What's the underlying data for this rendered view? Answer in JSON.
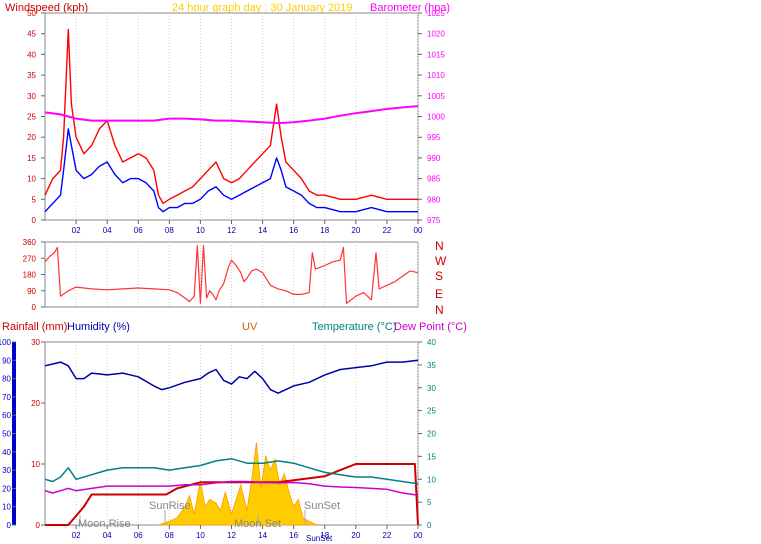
{
  "colors": {
    "wind_red": "#ff0000",
    "wind_blue": "#0000ff",
    "baro": "#ff00ff",
    "title_gold": "#ffcc00",
    "axis_darkred": "#cc0000",
    "axis_blue": "#0000cc",
    "humidity_navy": "#0000aa",
    "uv_brown": "#cc6600",
    "temp_teal": "#008080",
    "dew_magenta": "#cc00cc",
    "rain_darkred": "#cc0000",
    "uv_fill": "#ffcc00",
    "uv_edge": "#ff9900",
    "dir_red": "#ff3333",
    "hours_blue": "#0000aa",
    "grid": "#999999"
  },
  "header": {
    "wind_label": "Windspeed (kph)",
    "title": "24 hour graph day : 30 January 2019",
    "baro_label": "Barometer (hpa)"
  },
  "bottom_header": {
    "rain_label": "Rainfall (mm)",
    "humidity_label": "Humidity (%)",
    "uv_label": "UV",
    "temp_label": "Temperature (°C)",
    "dew_label": "Dew Point (°C)"
  },
  "compass": [
    "N",
    "W",
    "S",
    "E",
    "N"
  ],
  "annotations": {
    "moon_rise": "Moon Rise",
    "sun_rise": "SunRise",
    "moon_set": "Moon Set",
    "sun_set": "SunSet"
  },
  "chart_data": [
    {
      "type": "line",
      "name": "wind-barometer",
      "x_unit": "hour",
      "xlim": [
        0,
        24
      ],
      "x_ticks": [
        "02",
        "04",
        "06",
        "08",
        "10",
        "12",
        "14",
        "16",
        "18",
        "20",
        "22",
        "00"
      ],
      "ylim_left": [
        0,
        50
      ],
      "y_ticks_left": [
        "0",
        "5",
        "10",
        "15",
        "20",
        "25",
        "30",
        "35",
        "40",
        "45",
        "50"
      ],
      "ylim_right": [
        975,
        1025
      ],
      "y_ticks_right": [
        "975",
        "980",
        "985",
        "990",
        "995",
        "1000",
        "1005",
        "1010",
        "1015",
        "1020",
        "1025"
      ],
      "series": [
        {
          "axis": "left",
          "color": "#ff0000",
          "x": [
            0,
            0.5,
            1,
            1.2,
            1.5,
            1.7,
            2,
            2.5,
            3,
            3.5,
            4,
            4.5,
            5,
            5.5,
            6,
            6.5,
            7,
            7.3,
            7.6,
            8,
            8.5,
            9,
            9.5,
            10,
            10.5,
            11,
            11.5,
            12,
            12.5,
            13,
            13.5,
            14,
            14.5,
            14.9,
            15.2,
            15.5,
            16,
            16.5,
            17,
            17.5,
            18,
            19,
            20,
            21,
            22,
            23,
            24
          ],
          "y": [
            6,
            10,
            12,
            20,
            46,
            28,
            20,
            16,
            18,
            22,
            24,
            18,
            14,
            15,
            16,
            15,
            12,
            6,
            4,
            5,
            6,
            7,
            8,
            10,
            12,
            14,
            10,
            9,
            10,
            12,
            14,
            16,
            18,
            28,
            20,
            14,
            12,
            10,
            7,
            6,
            6,
            5,
            5,
            6,
            5,
            5,
            5
          ]
        },
        {
          "axis": "left",
          "color": "#0000ff",
          "x": [
            0,
            0.5,
            1,
            1.2,
            1.5,
            1.7,
            2,
            2.5,
            3,
            3.5,
            4,
            4.5,
            5,
            5.5,
            6,
            6.5,
            7,
            7.3,
            7.6,
            8,
            8.5,
            9,
            9.5,
            10,
            10.5,
            11,
            11.5,
            12,
            12.5,
            13,
            13.5,
            14,
            14.5,
            14.9,
            15.2,
            15.5,
            16,
            16.5,
            17,
            17.5,
            18,
            19,
            20,
            21,
            22,
            23,
            24
          ],
          "y": [
            2,
            4,
            6,
            12,
            22,
            18,
            12,
            10,
            11,
            13,
            14,
            11,
            9,
            10,
            10,
            9,
            7,
            3,
            2,
            3,
            3,
            4,
            4,
            5,
            7,
            8,
            6,
            5,
            6,
            7,
            8,
            9,
            10,
            15,
            12,
            8,
            7,
            6,
            4,
            3,
            3,
            2,
            2,
            3,
            2,
            2,
            2
          ]
        },
        {
          "axis": "right",
          "color": "#ff00ff",
          "x": [
            0,
            1,
            2,
            3,
            4,
            5,
            6,
            7,
            8,
            9,
            10,
            11,
            12,
            13,
            14,
            15,
            16,
            17,
            18,
            19,
            20,
            21,
            22,
            23,
            24
          ],
          "y": [
            1001,
            1000.5,
            999.5,
            999,
            999,
            999,
            999,
            999,
            999.5,
            999.5,
            999.3,
            999,
            999,
            998.8,
            998.6,
            998.4,
            998.6,
            999,
            999.5,
            1000.2,
            1000.8,
            1001.3,
            1001.8,
            1002.2,
            1002.5
          ]
        }
      ]
    },
    {
      "type": "line",
      "name": "wind-direction",
      "x_unit": "hour",
      "xlim": [
        0,
        24
      ],
      "ylim": [
        0,
        360
      ],
      "y_ticks": [
        "0",
        "90",
        "180",
        "270",
        "360"
      ],
      "series": [
        {
          "color": "#ff3333",
          "x": [
            0,
            0.3,
            0.6,
            0.8,
            1,
            1.5,
            2,
            3,
            4,
            5,
            6,
            7,
            8,
            8.5,
            9,
            9.3,
            9.6,
            9.8,
            10,
            10.2,
            10.4,
            10.6,
            10.8,
            11,
            11.2,
            11.5,
            11.8,
            12,
            12.3,
            12.6,
            12.8,
            13,
            13.3,
            13.6,
            14,
            14.5,
            15,
            15.5,
            16,
            16.5,
            17,
            17.2,
            17.4,
            18,
            18.5,
            19,
            19.2,
            19.4,
            20,
            20.5,
            21,
            21.3,
            21.5,
            22,
            22.5,
            23,
            23.5,
            24
          ],
          "y": [
            250,
            280,
            300,
            330,
            60,
            90,
            110,
            100,
            95,
            100,
            105,
            100,
            95,
            80,
            50,
            30,
            60,
            340,
            20,
            340,
            50,
            90,
            70,
            40,
            90,
            130,
            220,
            260,
            230,
            190,
            140,
            160,
            200,
            210,
            190,
            120,
            100,
            90,
            70,
            70,
            80,
            300,
            210,
            230,
            250,
            260,
            330,
            20,
            60,
            80,
            40,
            300,
            100,
            120,
            140,
            170,
            200,
            190
          ]
        }
      ]
    },
    {
      "type": "area",
      "name": "rain-humidity-uv-temp",
      "x_unit": "hour",
      "xlim": [
        0,
        24
      ],
      "y_rain_ticks": [
        "0",
        "10",
        "20",
        "30"
      ],
      "ylim_rain": [
        0,
        30
      ],
      "y_hum_ticks": [
        "0",
        "10",
        "20",
        "30",
        "40",
        "50",
        "60",
        "70",
        "80",
        "90",
        "100"
      ],
      "ylim_hum": [
        0,
        100
      ],
      "y_temp_ticks": [
        "0",
        "5",
        "10",
        "15",
        "20",
        "25",
        "30",
        "35",
        "40"
      ],
      "ylim_temp": [
        0,
        40
      ],
      "series": [
        {
          "name": "Humidity (%)",
          "axis": "hum",
          "color": "#0000aa",
          "x": [
            0,
            0.5,
            1,
            1.5,
            2,
            2.5,
            3,
            4,
            5,
            6,
            7,
            7.5,
            8,
            9,
            10,
            10.5,
            11,
            11.5,
            12,
            12.5,
            13,
            13.5,
            14,
            14.5,
            15,
            15.5,
            16,
            17,
            18,
            19,
            20,
            21,
            22,
            23,
            24
          ],
          "y": [
            87,
            88,
            89,
            87,
            80,
            80,
            83,
            82,
            83,
            81,
            76,
            74,
            75,
            78,
            80,
            83,
            85,
            79,
            77,
            81,
            80,
            84,
            80,
            74,
            72,
            74,
            76,
            78,
            82,
            85,
            86,
            87,
            89,
            89,
            90
          ]
        },
        {
          "name": "Rainfall (mm)",
          "axis": "rain",
          "color": "#cc0000",
          "x": [
            0,
            1.5,
            2.5,
            3,
            6,
            7.8,
            8.5,
            10,
            10.5,
            12,
            15,
            18,
            19,
            20,
            23.8,
            24
          ],
          "y": [
            0,
            0,
            3,
            5,
            5,
            5,
            6,
            7,
            7,
            7,
            7,
            8,
            9,
            10,
            10,
            0
          ]
        },
        {
          "name": "Temperature (°C)",
          "axis": "temp",
          "color": "#008080",
          "x": [
            0,
            0.5,
            1,
            1.5,
            2,
            3,
            4,
            5,
            6,
            7,
            8,
            9,
            10,
            11,
            12,
            13,
            14,
            15,
            16,
            17,
            18,
            19,
            20,
            21,
            22,
            23,
            24
          ],
          "y": [
            10,
            9.5,
            10.5,
            12.5,
            10,
            11,
            12,
            12.5,
            12.5,
            12.5,
            12,
            12.5,
            13,
            14,
            14.5,
            13.5,
            13.5,
            14,
            13.5,
            12.5,
            11.5,
            11,
            10.5,
            10.5,
            10,
            9.5,
            9
          ]
        },
        {
          "name": "Dew Point (°C)",
          "axis": "temp",
          "color": "#cc00cc",
          "x": [
            0,
            0.5,
            1,
            1.5,
            2,
            3,
            4,
            5,
            6,
            7,
            8,
            9,
            10,
            11,
            12,
            13,
            14,
            15,
            16,
            17,
            18,
            19,
            20,
            21,
            22,
            23,
            24
          ],
          "y": [
            7.5,
            7,
            7.5,
            8,
            7.5,
            8,
            8.5,
            8.5,
            8.5,
            8.5,
            8.5,
            8.8,
            8.8,
            9.2,
            9.5,
            9.5,
            9.3,
            9.2,
            9.3,
            9,
            8.5,
            8.3,
            8.2,
            8,
            7.8,
            7,
            6.5
          ]
        },
        {
          "name": "UV",
          "axis": "hum",
          "color": "#ffcc00",
          "x": [
            7.3,
            8,
            8.5,
            9,
            9.3,
            9.6,
            10,
            10.3,
            10.6,
            11,
            11.3,
            11.6,
            12,
            12.3,
            12.6,
            13,
            13.3,
            13.6,
            13.9,
            14.2,
            14.5,
            14.8,
            15.1,
            15.4,
            15.7,
            16,
            16.3,
            16.6,
            17,
            17.5
          ],
          "y": [
            0,
            2,
            4,
            10,
            16,
            6,
            24,
            10,
            14,
            12,
            8,
            18,
            6,
            14,
            22,
            8,
            25,
            45,
            20,
            38,
            30,
            36,
            22,
            28,
            18,
            10,
            14,
            4,
            2,
            0
          ]
        }
      ]
    }
  ]
}
